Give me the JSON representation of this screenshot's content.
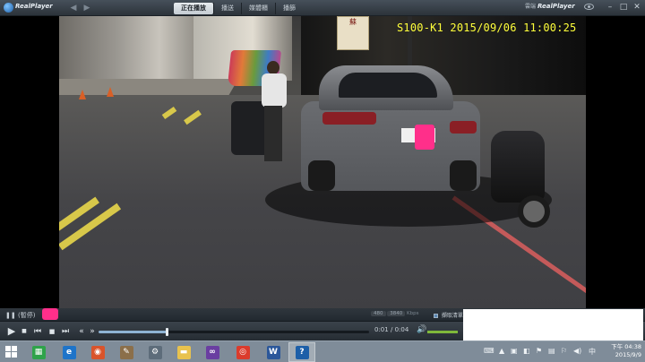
{
  "window": {
    "logo_text": "RealPlayer",
    "tabs": [
      {
        "label": "正在播放",
        "active": true
      },
      {
        "label": "播送",
        "active": false
      },
      {
        "label": "媒體櫃",
        "active": false
      },
      {
        "label": "播篩",
        "active": false
      }
    ],
    "brand_small": "雲端",
    "brand_name": "RealPlayer",
    "controls": {
      "minimize": "–",
      "maximize": "□",
      "close": "✕"
    }
  },
  "video": {
    "osd_text": "S100-K1 2015/09/06 11:00:25",
    "sign_text": "蘇"
  },
  "status": {
    "state_text": "(暫停)",
    "format_chips": [
      "480",
      "3840",
      "Kbps"
    ],
    "clear_label": "擷取清單",
    "clear_checked": true
  },
  "playback": {
    "time_current": "0:01",
    "time_separator": "/",
    "time_total": "0:04",
    "progress_fraction": 0.25,
    "volume_fraction": 1.0
  },
  "taskbar": {
    "apps": [
      {
        "name": "store-app",
        "icon": "store-icon",
        "color": "#2fa34a"
      },
      {
        "name": "ie-app",
        "icon": "ie-icon",
        "color": "#1e74c9"
      },
      {
        "name": "chrome-plugin-app",
        "icon": "globe-icon",
        "color": "#d9542b"
      },
      {
        "name": "tool-app",
        "icon": "tool-icon",
        "color": "#8b6f4a"
      },
      {
        "name": "settings-app",
        "icon": "gear-icon",
        "color": "#5d6c7a"
      },
      {
        "name": "explorer-app",
        "icon": "folder-icon",
        "color": "#e8c24e"
      },
      {
        "name": "vs-app",
        "icon": "visualstudio-icon",
        "color": "#6a3ea1"
      },
      {
        "name": "chrome-app",
        "icon": "chrome-icon",
        "color": "#db3b2c"
      },
      {
        "name": "word-app",
        "icon": "word-icon",
        "color": "#2b579a"
      },
      {
        "name": "realplayer-app",
        "icon": "realplayer-icon",
        "color": "#1d5fa8"
      }
    ],
    "clock_time": "下午 04:38",
    "clock_date": "2015/9/9"
  }
}
